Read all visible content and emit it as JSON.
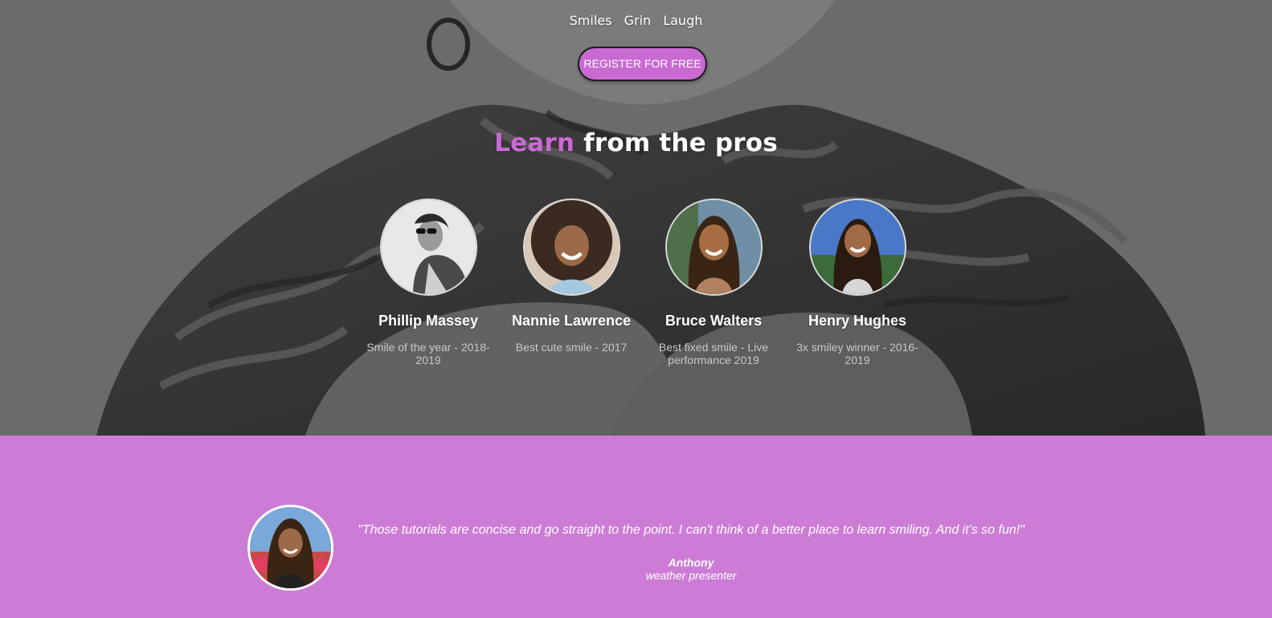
{
  "nav": {
    "items": [
      "Smiles",
      "Grin",
      "Laugh"
    ]
  },
  "hero": {
    "cta_label": "REGISTER FOR FREE",
    "headline_accent": "Learn",
    "headline_rest": " from the pros"
  },
  "pros": [
    {
      "name": "Phillip Massey",
      "desc": "Smile of the year - 2018-2019"
    },
    {
      "name": "Nannie Lawrence",
      "desc": "Best cute smile - 2017"
    },
    {
      "name": "Bruce Walters",
      "desc": "Best fixed smile - Live performance 2019"
    },
    {
      "name": "Henry Hughes",
      "desc": "3x smiley winner - 2016-2019"
    }
  ],
  "testimonial": {
    "quote": "\"Those tutorials are concise and go straight to the point. I can't think of a better place to learn smiling. And it's so fun!\"",
    "author": "Anthony",
    "role": "weather presenter"
  },
  "colors": {
    "accent": "#c96ad3",
    "testimonial_bg": "#cd7cd6"
  }
}
